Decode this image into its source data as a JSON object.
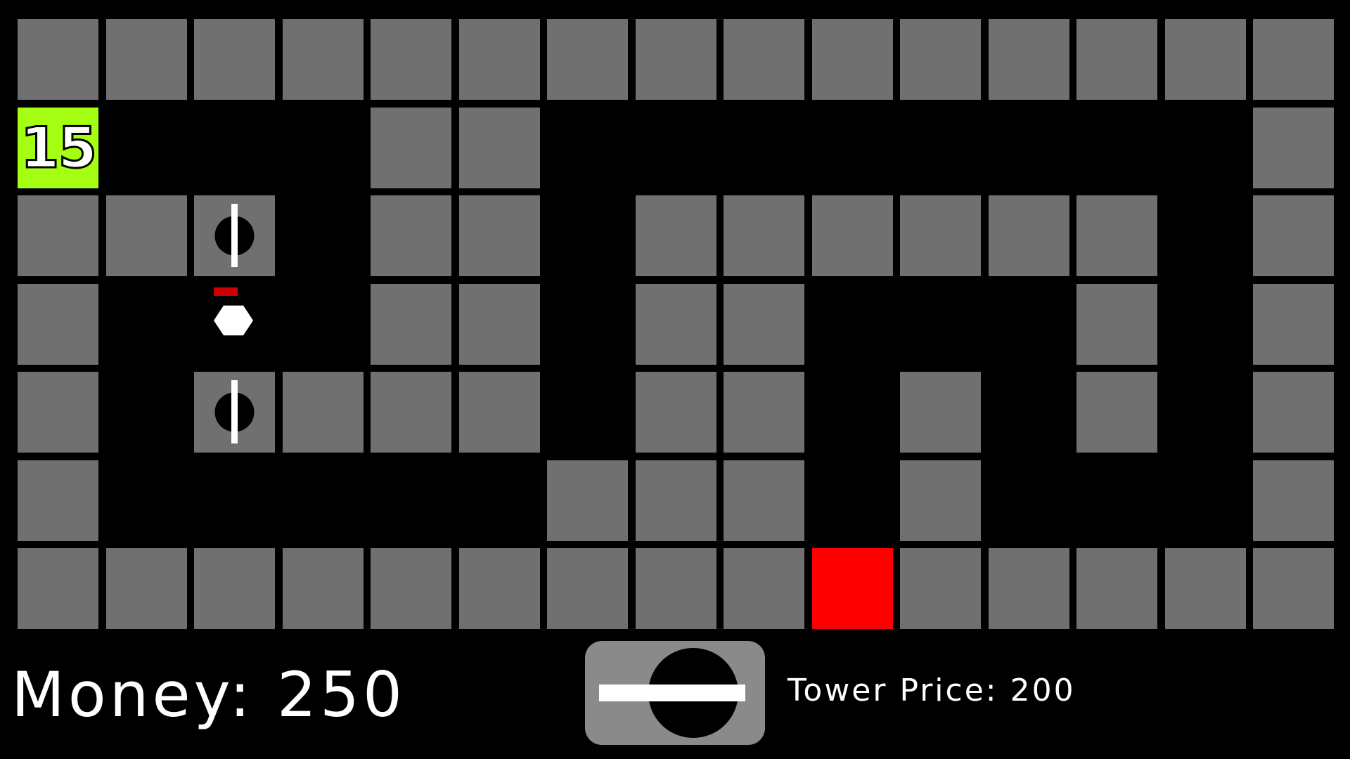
{
  "board": {
    "cols": 15,
    "rows": 7,
    "map": [
      "###############",
      "S...##........#",
      "###.##.######.#",
      "#...##.##...#.#",
      "#.####.##.#.#.#",
      "#.....###.#...#",
      "#########G#####"
    ],
    "spawn_countdown": "15",
    "colors": {
      "wall": "#707070",
      "path": "#000000",
      "spawn": "#a4ff12",
      "goal": "#ff0000",
      "enemy": "#ffffff",
      "enemy_health": "#cc0000"
    }
  },
  "towers": [
    {
      "row": 2,
      "col": 2
    },
    {
      "row": 4,
      "col": 2
    }
  ],
  "enemies": [
    {
      "row": 3,
      "col": 2,
      "health": 0.6
    }
  ],
  "hud": {
    "money_text": "Money: 250",
    "tower_price_text": "Tower Price: 200"
  },
  "shop": {
    "item": "tower-icon"
  }
}
